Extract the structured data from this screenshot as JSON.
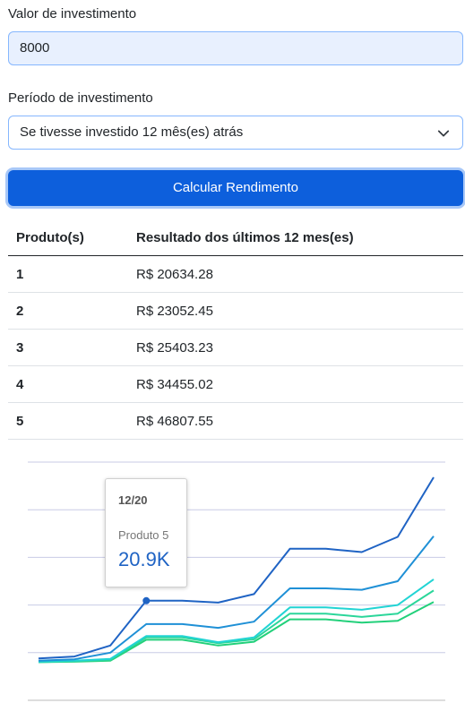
{
  "form": {
    "amount_label": "Valor de investimento",
    "amount_value": "8000",
    "period_label": "Período de investimento",
    "period_value": "Se tivesse investido 12 mês(es) atrás",
    "submit_label": "Calcular Rendimento"
  },
  "table": {
    "headers": [
      "Produto(s)",
      "Resultado dos últimos 12 mes(es)"
    ],
    "rows": [
      {
        "product": "1",
        "result": "R$ 20634.28"
      },
      {
        "product": "2",
        "result": "R$ 23052.45"
      },
      {
        "product": "3",
        "result": "R$ 25403.23"
      },
      {
        "product": "4",
        "result": "R$ 34455.02"
      },
      {
        "product": "5",
        "result": "R$ 46807.55"
      }
    ]
  },
  "tooltip": {
    "date": "12/20",
    "series": "Produto 5",
    "value": "20.9K"
  },
  "chart_data": {
    "type": "line",
    "x": [
      "1",
      "2",
      "3",
      "4",
      "5",
      "6",
      "7",
      "8",
      "9",
      "10",
      "11",
      "12"
    ],
    "ylim": [
      0,
      50000
    ],
    "grid": true,
    "series": [
      {
        "color": "#22d07a",
        "values": [
          8000,
          8100,
          8300,
          12700,
          12700,
          11500,
          12300,
          17000,
          17000,
          16300,
          16700,
          20634.28
        ]
      },
      {
        "color": "#2bd69a",
        "values": [
          8000,
          8200,
          8500,
          13200,
          13200,
          12000,
          12800,
          18200,
          18200,
          17500,
          18200,
          23052.45
        ]
      },
      {
        "color": "#22d4d4",
        "values": [
          8100,
          8300,
          8700,
          13500,
          13500,
          12200,
          13200,
          19500,
          19500,
          19000,
          20000,
          25403.23
        ]
      },
      {
        "color": "#1f90d6",
        "values": [
          8300,
          8600,
          10000,
          16000,
          16000,
          15200,
          16500,
          23500,
          23500,
          23200,
          25000,
          34455.02
        ]
      },
      {
        "color": "#1f63c4",
        "values": [
          8800,
          9200,
          11500,
          20900,
          20900,
          20500,
          22300,
          31800,
          31800,
          31100,
          34300,
          46807.55
        ]
      }
    ]
  },
  "icons": {
    "select_arrow": "chevron-down-icon"
  }
}
